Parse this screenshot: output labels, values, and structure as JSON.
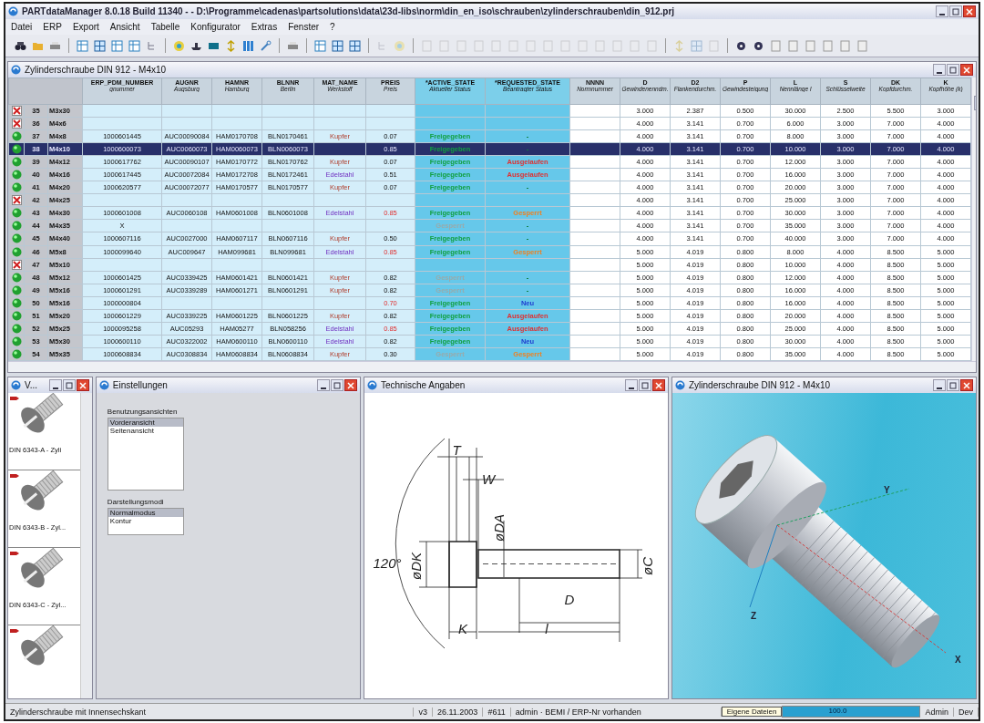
{
  "window": {
    "title": "PARTdataManager 8.0.18 Build 11340 -  - D:\\Programme\\cadenas\\partsolutions\\data\\23d-libs\\norm\\din_en_iso\\schrauben\\zylinderschrauben\\din_912.prj"
  },
  "menu": [
    "Datei",
    "ERP",
    "Export",
    "Ansicht",
    "Tabelle",
    "Konfigurator",
    "Extras",
    "Fenster",
    "?"
  ],
  "table_window": {
    "title": "Zylinderschraube DIN 912 - M4x10"
  },
  "columns": [
    {
      "name": "ERP_PDM_NUMBER",
      "sub": "gnummer",
      "kind": "text"
    },
    {
      "name": "AUGNR",
      "sub": "Augsburg",
      "kind": "text"
    },
    {
      "name": "HAMNR",
      "sub": "Hamburg",
      "kind": "text"
    },
    {
      "name": "BLNNR",
      "sub": "Berlin",
      "kind": "text"
    },
    {
      "name": "MAT_NAME",
      "sub": "Werkstoff",
      "kind": "text"
    },
    {
      "name": "PREIS",
      "sub": "Preis",
      "kind": "text"
    },
    {
      "name": "*ACTIVE_STATE",
      "sub": "Aktueller Status",
      "kind": "state"
    },
    {
      "name": "*REQUESTED_STATE",
      "sub": "Beantragter Status",
      "kind": "state"
    },
    {
      "name": "NNNN",
      "sub": "Normnummer",
      "kind": "text"
    },
    {
      "name": "D",
      "sub": "Gewindenenndm.",
      "kind": "dim"
    },
    {
      "name": "D2",
      "sub": "Flankendurchm.",
      "kind": "dim"
    },
    {
      "name": "P",
      "sub": "Gewindesteigung",
      "kind": "dim"
    },
    {
      "name": "L",
      "sub": "Nennlänge l",
      "kind": "dim"
    },
    {
      "name": "S",
      "sub": "Schlüsselweite",
      "kind": "dim"
    },
    {
      "name": "DK",
      "sub": "Kopfdurchm.",
      "kind": "dim"
    },
    {
      "name": "K",
      "sub": "Kopfhöhe (k)",
      "kind": "dim"
    }
  ],
  "rows": [
    {
      "valid": false,
      "num": "35",
      "name": "M3x30",
      "selected": false,
      "dims": [
        "3.000",
        "2.387",
        "0.500",
        "30.000",
        "2.500",
        "5.500",
        "3.000"
      ]
    },
    {
      "valid": false,
      "num": "36",
      "name": "M4x6",
      "selected": false,
      "dims": [
        "4.000",
        "3.141",
        "0.700",
        "6.000",
        "3.000",
        "7.000",
        "4.000"
      ]
    },
    {
      "valid": true,
      "num": "37",
      "name": "M4x8",
      "selected": false,
      "erp": "1000601445",
      "aug": "AUC00090084",
      "ham": "HAM0170708",
      "bln": "BLN0170461",
      "mat": {
        "text": "Kupfer",
        "kind": "copper"
      },
      "price": "0.07",
      "price_alert": false,
      "active": {
        "text": "Freigegeben",
        "kind": "released"
      },
      "requested": {
        "text": "-",
        "kind": "none"
      },
      "dims": [
        "4.000",
        "3.141",
        "0.700",
        "8.000",
        "3.000",
        "7.000",
        "4.000"
      ]
    },
    {
      "valid": true,
      "num": "38",
      "name": "M4x10",
      "selected": true,
      "erp": "1000600073",
      "aug": "AUC0060073",
      "ham": "HAM0060073",
      "bln": "BLN0060073",
      "price": "0.85",
      "price_alert": true,
      "active": {
        "text": "Freigegeben",
        "kind": "released"
      },
      "requested": {
        "text": "-",
        "kind": "none"
      },
      "dims": [
        "4.000",
        "3.141",
        "0.700",
        "10.000",
        "3.000",
        "7.000",
        "4.000"
      ]
    },
    {
      "valid": true,
      "num": "39",
      "name": "M4x12",
      "selected": false,
      "erp": "1000617762",
      "aug": "AUC00090107",
      "ham": "HAM0170772",
      "bln": "BLN0170762",
      "mat": {
        "text": "Kupfer",
        "kind": "copper"
      },
      "price": "0.07",
      "price_alert": false,
      "active": {
        "text": "Freigegeben",
        "kind": "released"
      },
      "requested": {
        "text": "Ausgelaufen",
        "kind": "expired"
      },
      "dims": [
        "4.000",
        "3.141",
        "0.700",
        "12.000",
        "3.000",
        "7.000",
        "4.000"
      ]
    },
    {
      "valid": true,
      "num": "40",
      "name": "M4x16",
      "selected": false,
      "erp": "1000617445",
      "aug": "AUC00072084",
      "ham": "HAM0172708",
      "bln": "BLN0172461",
      "mat": {
        "text": "Edelstahl",
        "kind": "steel"
      },
      "price": "0.51",
      "price_alert": false,
      "active": {
        "text": "Freigegeben",
        "kind": "released"
      },
      "requested": {
        "text": "Ausgelaufen",
        "kind": "expired"
      },
      "dims": [
        "4.000",
        "3.141",
        "0.700",
        "16.000",
        "3.000",
        "7.000",
        "4.000"
      ]
    },
    {
      "valid": true,
      "num": "41",
      "name": "M4x20",
      "selected": false,
      "erp": "1000620577",
      "aug": "AUC00072077",
      "ham": "HAM0170577",
      "bln": "BLN0170577",
      "mat": {
        "text": "Kupfer",
        "kind": "copper"
      },
      "price": "0.07",
      "price_alert": false,
      "active": {
        "text": "Freigegeben",
        "kind": "released"
      },
      "requested": {
        "text": "-",
        "kind": "none"
      },
      "dims": [
        "4.000",
        "3.141",
        "0.700",
        "20.000",
        "3.000",
        "7.000",
        "4.000"
      ]
    },
    {
      "valid": false,
      "num": "42",
      "name": "M4x25",
      "selected": false,
      "dims": [
        "4.000",
        "3.141",
        "0.700",
        "25.000",
        "3.000",
        "7.000",
        "4.000"
      ]
    },
    {
      "valid": true,
      "num": "43",
      "name": "M4x30",
      "selected": false,
      "erp": "1000601008",
      "aug": "AUC0060108",
      "ham": "HAM0601008",
      "bln": "BLN0601008",
      "mat": {
        "text": "Edelstahl",
        "kind": "steel"
      },
      "price": "0.85",
      "price_alert": true,
      "active": {
        "text": "Freigegeben",
        "kind": "released"
      },
      "requested": {
        "text": "Gesperrt",
        "kind": "locked"
      },
      "dims": [
        "4.000",
        "3.141",
        "0.700",
        "30.000",
        "3.000",
        "7.000",
        "4.000"
      ]
    },
    {
      "valid": true,
      "num": "44",
      "name": "M4x35",
      "selected": false,
      "erp": "X",
      "active": {
        "text": "Gesperrt",
        "kind": "locked"
      },
      "requested": {
        "text": "-",
        "kind": "none"
      },
      "dims": [
        "4.000",
        "3.141",
        "0.700",
        "35.000",
        "3.000",
        "7.000",
        "4.000"
      ]
    },
    {
      "valid": true,
      "num": "45",
      "name": "M4x40",
      "selected": false,
      "erp": "1000607116",
      "aug": "AUC0027000",
      "ham": "HAM0607117",
      "bln": "BLN0607116",
      "mat": {
        "text": "Kupfer",
        "kind": "copper"
      },
      "price": "0.50",
      "price_alert": false,
      "active": {
        "text": "Freigegeben",
        "kind": "released"
      },
      "requested": {
        "text": "-",
        "kind": "none"
      },
      "dims": [
        "4.000",
        "3.141",
        "0.700",
        "40.000",
        "3.000",
        "7.000",
        "4.000"
      ]
    },
    {
      "valid": true,
      "num": "46",
      "name": "M5x8",
      "selected": false,
      "erp": "1000099640",
      "aug": "AUC009647",
      "ham": "HAM099681",
      "bln": "BLN099681",
      "mat": {
        "text": "Edelstahl",
        "kind": "steel"
      },
      "price": "0.85",
      "price_alert": true,
      "active": {
        "text": "Freigegeben",
        "kind": "released"
      },
      "requested": {
        "text": "Gesperrt",
        "kind": "locked"
      },
      "dims": [
        "5.000",
        "4.019",
        "0.800",
        "8.000",
        "4.000",
        "8.500",
        "5.000"
      ]
    },
    {
      "valid": false,
      "num": "47",
      "name": "M5x10",
      "selected": false,
      "dims": [
        "5.000",
        "4.019",
        "0.800",
        "10.000",
        "4.000",
        "8.500",
        "5.000"
      ]
    },
    {
      "valid": true,
      "num": "48",
      "name": "M5x12",
      "selected": false,
      "erp": "1000601425",
      "aug": "AUC0339425",
      "ham": "HAM0601421",
      "bln": "BLN0601421",
      "mat": {
        "text": "Kupfer",
        "kind": "copper"
      },
      "price": "0.82",
      "price_alert": false,
      "active": {
        "text": "Gesperrt",
        "kind": "locked"
      },
      "requested": {
        "text": "-",
        "kind": "none"
      },
      "dims": [
        "5.000",
        "4.019",
        "0.800",
        "12.000",
        "4.000",
        "8.500",
        "5.000"
      ]
    },
    {
      "valid": true,
      "num": "49",
      "name": "M5x16",
      "selected": false,
      "erp": "1000601291",
      "aug": "AUC0339289",
      "ham": "HAM0601271",
      "bln": "BLN0601291",
      "mat": {
        "text": "Kupfer",
        "kind": "copper"
      },
      "price": "0.82",
      "price_alert": false,
      "active": {
        "text": "Gesperrt",
        "kind": "locked"
      },
      "requested": {
        "text": "-",
        "kind": "none"
      },
      "dims": [
        "5.000",
        "4.019",
        "0.800",
        "16.000",
        "4.000",
        "8.500",
        "5.000"
      ]
    },
    {
      "valid": true,
      "num": "50",
      "name": "M5x16",
      "selected": false,
      "erp": "1000000804",
      "price": "0.70",
      "price_alert": true,
      "active": {
        "text": "Freigegeben",
        "kind": "released"
      },
      "requested": {
        "text": "Neu",
        "kind": "new"
      },
      "dims": [
        "5.000",
        "4.019",
        "0.800",
        "16.000",
        "4.000",
        "8.500",
        "5.000"
      ]
    },
    {
      "valid": true,
      "num": "51",
      "name": "M5x20",
      "selected": false,
      "erp": "1000601229",
      "aug": "AUC0339225",
      "ham": "HAM0601225",
      "bln": "BLN0601225",
      "mat": {
        "text": "Kupfer",
        "kind": "copper"
      },
      "price": "0.82",
      "price_alert": false,
      "active": {
        "text": "Freigegeben",
        "kind": "released"
      },
      "requested": {
        "text": "Ausgelaufen",
        "kind": "expired"
      },
      "dims": [
        "5.000",
        "4.019",
        "0.800",
        "20.000",
        "4.000",
        "8.500",
        "5.000"
      ]
    },
    {
      "valid": true,
      "num": "52",
      "name": "M5x25",
      "selected": false,
      "erp": "1000095258",
      "aug": "AUC05293",
      "ham": "HAM05277",
      "bln": "BLN058256",
      "mat": {
        "text": "Edelstahl",
        "kind": "steel"
      },
      "price": "0.85",
      "price_alert": true,
      "active": {
        "text": "Freigegeben",
        "kind": "released"
      },
      "requested": {
        "text": "Ausgelaufen",
        "kind": "expired"
      },
      "dims": [
        "5.000",
        "4.019",
        "0.800",
        "25.000",
        "4.000",
        "8.500",
        "5.000"
      ]
    },
    {
      "valid": true,
      "num": "53",
      "name": "M5x30",
      "selected": false,
      "erp": "1000600110",
      "aug": "AUC0322002",
      "ham": "HAM0600110",
      "bln": "BLN0600110",
      "mat": {
        "text": "Edelstahl",
        "kind": "steel"
      },
      "price": "0.82",
      "price_alert": false,
      "active": {
        "text": "Freigegeben",
        "kind": "released"
      },
      "requested": {
        "text": "Neu",
        "kind": "new"
      },
      "dims": [
        "5.000",
        "4.019",
        "0.800",
        "30.000",
        "4.000",
        "8.500",
        "5.000"
      ]
    },
    {
      "valid": true,
      "num": "54",
      "name": "M5x35",
      "selected": false,
      "erp": "1000608834",
      "aug": "AUC0308834",
      "ham": "HAM0608834",
      "bln": "BLN0608834",
      "mat": {
        "text": "Kupfer",
        "kind": "copper"
      },
      "price": "0.30",
      "price_alert": false,
      "active": {
        "text": "Gesperrt",
        "kind": "locked"
      },
      "requested": {
        "text": "Gesperrt",
        "kind": "locked"
      },
      "dims": [
        "5.000",
        "4.019",
        "0.800",
        "35.000",
        "4.000",
        "8.500",
        "5.000"
      ]
    }
  ],
  "variants_panel": {
    "title": "V...",
    "items": [
      {
        "kind": "screw",
        "caption": "DIN 6343-A - Zyli"
      },
      {
        "kind": "screw",
        "caption": "DIN 6343-B - Zyl..."
      },
      {
        "kind": "screw",
        "caption": "DIN 6343-C - Zyl..."
      },
      {
        "kind": "screw"
      }
    ]
  },
  "settings_panel": {
    "title": "Einstellungen",
    "lists": [
      {
        "label": "Benutzungsansichten",
        "items": [
          {
            "text": "Vorderansicht",
            "selected": true
          },
          {
            "text": "Seitenansicht",
            "selected": false
          }
        ]
      },
      {
        "label": "Darstellungsmodi",
        "items": [
          {
            "text": "Normalmodus",
            "selected": true
          },
          {
            "text": "Kontur",
            "selected": false
          }
        ]
      }
    ]
  },
  "drawing_panel": {
    "title": "Technische Angaben",
    "labels": [
      "T",
      "W",
      "øDA",
      "120°",
      "øDK",
      "øC",
      "D",
      "K",
      "l"
    ]
  },
  "view_panel": {
    "title": "Zylinderschraube DIN 912 - M4x10",
    "axes": [
      "Y",
      "Z",
      "X"
    ]
  },
  "status_bar": {
    "text": "Zylinderschraube mit Innensechskant",
    "version": "v3",
    "date": "26.11.2003",
    "number": "#611",
    "info": "admin · BEMI / ERP-Nr vorhanden",
    "folder": "Eigene Dateien",
    "progress": {
      "text": "100.0",
      "level": 1.0
    },
    "user": "Admin",
    "mode": "Dev"
  }
}
